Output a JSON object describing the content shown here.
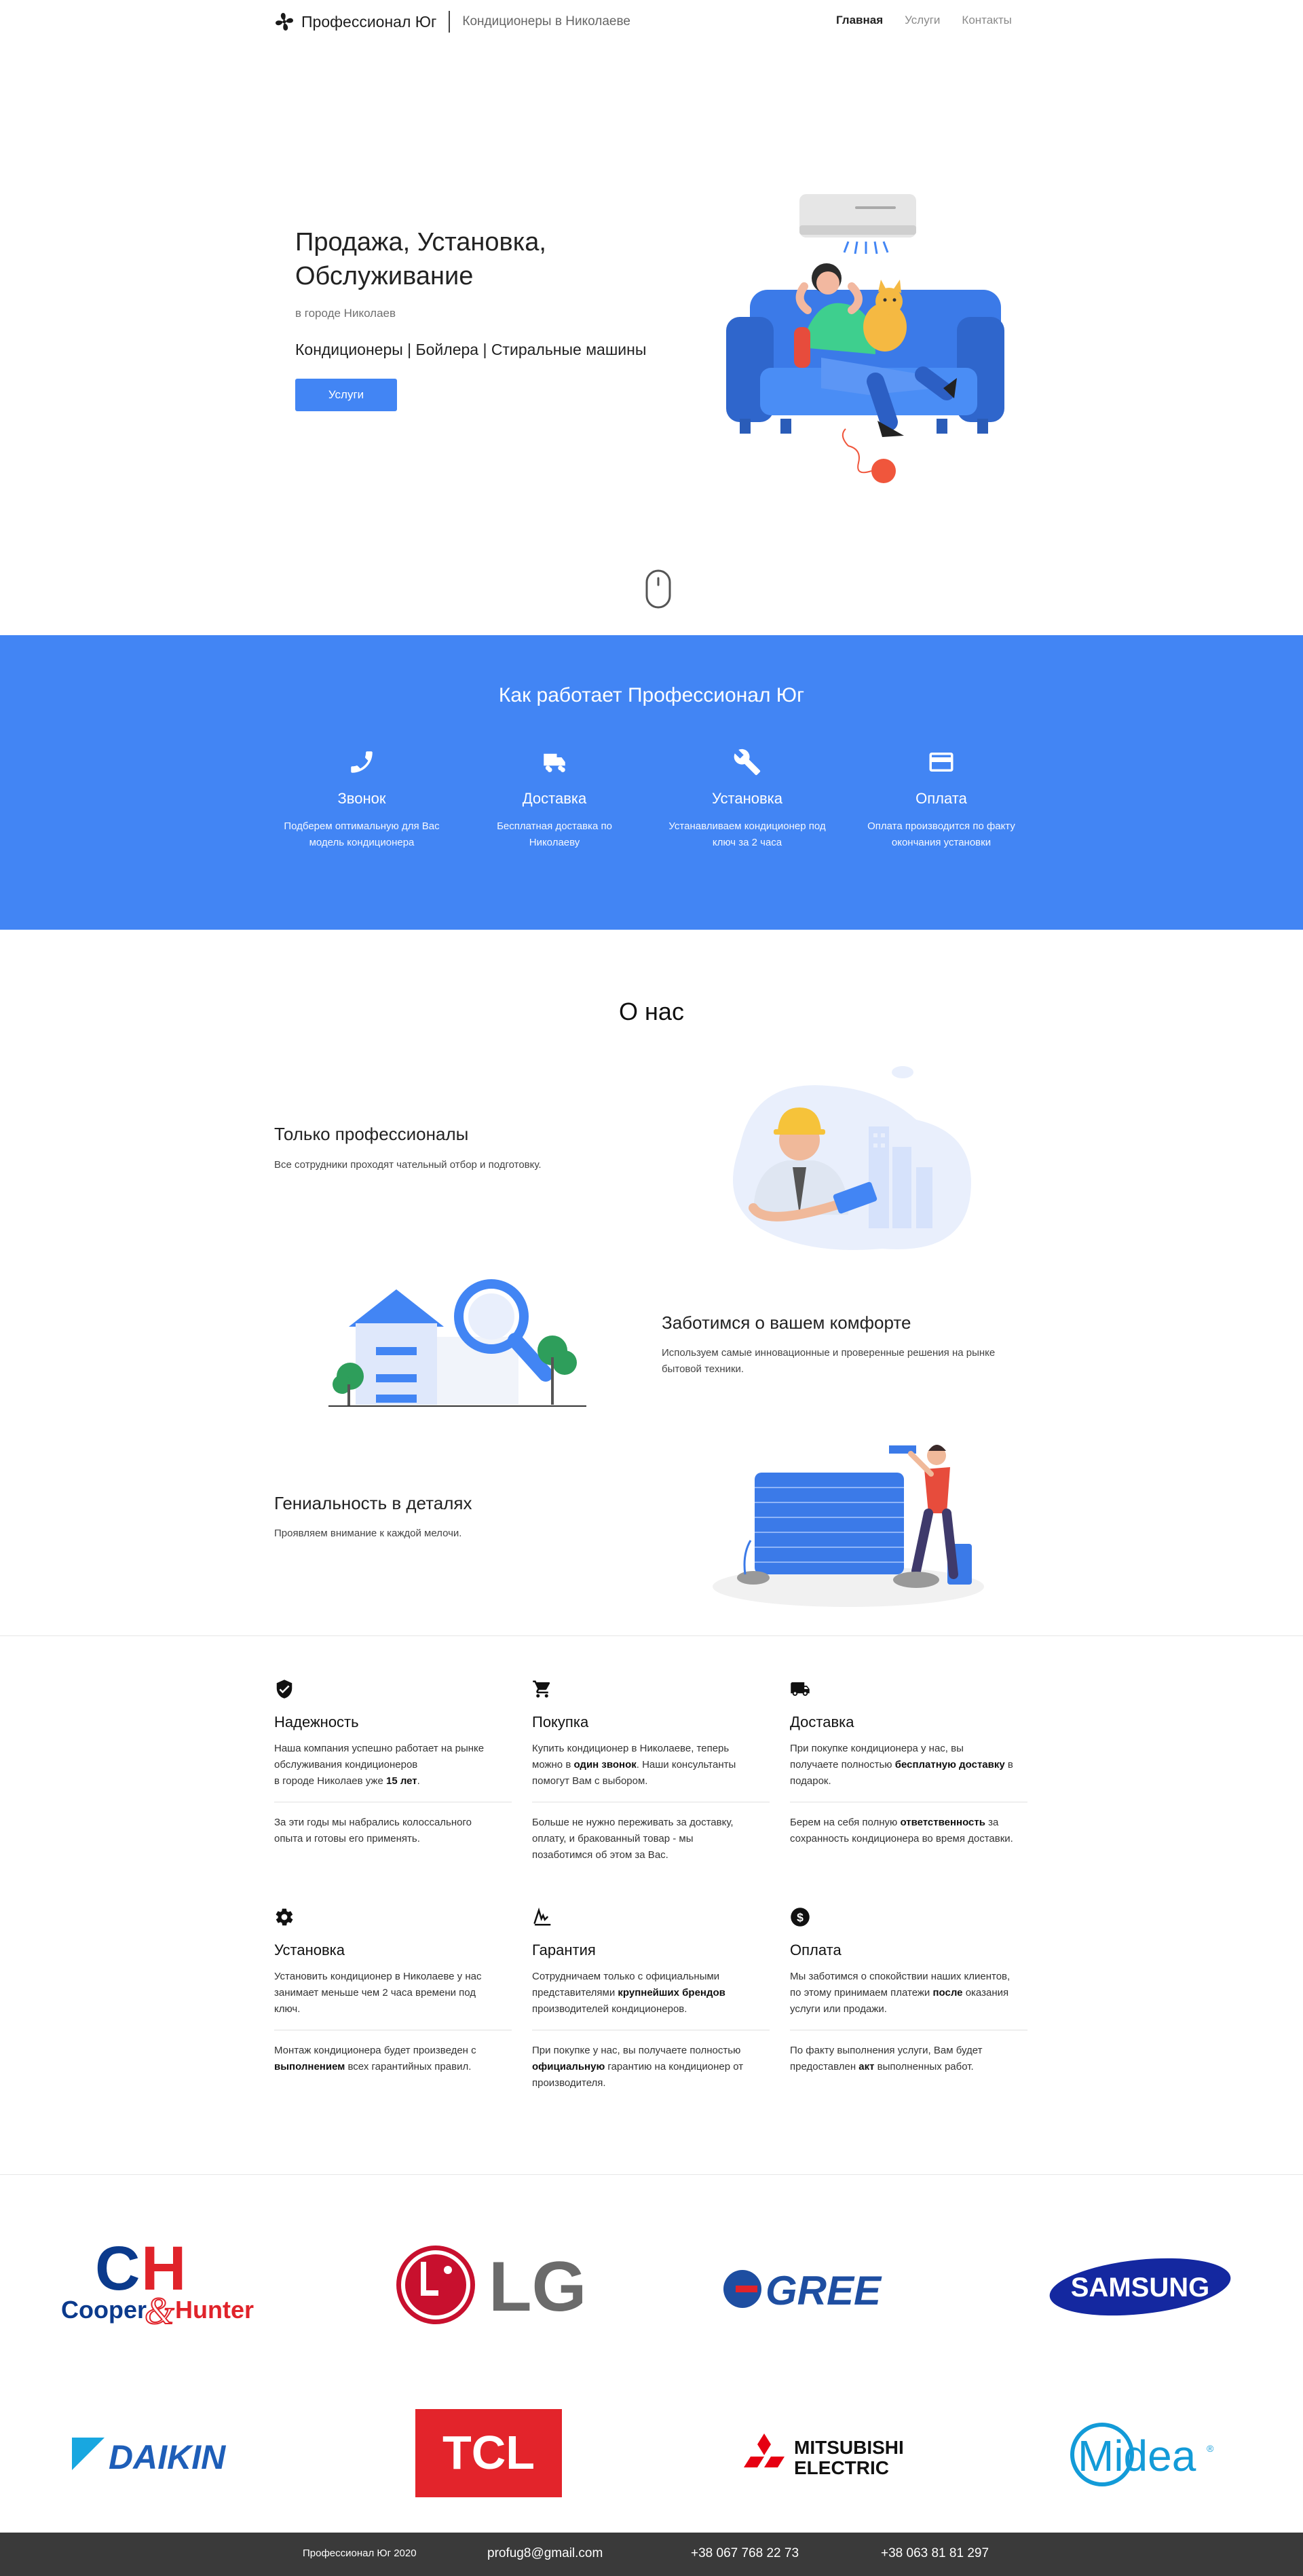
{
  "header": {
    "brand_name": "Профессионал Юг",
    "brand_sub": "Кондиционеры в Николаеве",
    "nav": [
      "Главная",
      "Услуги",
      "Контакты"
    ]
  },
  "hero": {
    "title_line1": "Продажа, Установка,",
    "title_line2": "Обслуживание",
    "city": "в городе Николаев",
    "categories": "Кондиционеры | Бойлера | Стиральные машины",
    "button": "Услуги"
  },
  "how": {
    "title": "Как работает Профессионал Юг",
    "steps": [
      {
        "icon": "phone-icon",
        "title": "Звонок",
        "desc1": "Подберем оптимальную для Вас",
        "desc2": "модель кондиционера"
      },
      {
        "icon": "truck-icon",
        "title": "Доставка",
        "desc1": "Бесплатная доставка по",
        "desc2": "Николаеву"
      },
      {
        "icon": "wrench-icon",
        "title": "Установка",
        "desc1": "Устанавливаем кондиционер под",
        "desc2": "ключ за 2 часа"
      },
      {
        "icon": "credit-card-icon",
        "title": "Оплата",
        "desc1": "Оплата производится по факту",
        "desc2": "окончания установки"
      }
    ]
  },
  "about": {
    "title": "О нас",
    "features": [
      {
        "title": "Только профессионалы",
        "text": "Все сотрудники проходят чательный отбор и подготовку."
      },
      {
        "title": "Заботимся о вашем комфорте",
        "text1": "Используем самые инновационные и проверенные решения на рынке",
        "text2": "бытовой техники."
      },
      {
        "title": "Гениальность в деталях",
        "text": "Проявляем внимание к каждой мелочи."
      }
    ]
  },
  "benefits": [
    {
      "icon": "shield-check-icon",
      "title": "Надежность",
      "p1": [
        "Наша компания успешно работает на рынке",
        "обслуживания кондиционеров",
        "в городе Николаев уже ",
        "15 лет",
        "."
      ],
      "p2": [
        "За эти годы мы набрались колоссального",
        "опыта и готовы его применять."
      ]
    },
    {
      "icon": "cart-icon",
      "title": "Покупка",
      "p1": [
        "Купить кондиционер в Николаеве, теперь",
        "можно в ",
        "один звонок",
        ". Наши консультанты",
        "помогут Вам с выбором."
      ],
      "p2": [
        "Больше не нужно переживать за доставку,",
        "оплату, и бракованный товар - мы",
        "позаботимся об этом за Вас."
      ]
    },
    {
      "icon": "truck-icon",
      "title": "Доставка",
      "p1": [
        "При покупке кондиционера у нас, вы",
        "получаете полностью ",
        "бесплатную доставку",
        " в",
        "подарок."
      ],
      "p2": [
        "Берем на себя полную ",
        "ответственность",
        " за",
        "сохранность кондиционера во время доставки."
      ]
    },
    {
      "icon": "gear-icon",
      "title": "Установка",
      "p1": [
        "Установить кондиционер в Николаеве у нас",
        "занимает меньше чем 2 часа времени под",
        "ключ."
      ],
      "p2": [
        "Монтаж кондиционера будет произведен с",
        "выполнением",
        " всех гарантийных правил."
      ]
    },
    {
      "icon": "signature-icon",
      "title": "Гарантия",
      "p1": [
        "Сотрудничаем только с официальными",
        "представителями ",
        "крупнейших брендов",
        "производителей кондиционеров."
      ],
      "p2": [
        "При покупке у нас, вы получаете полностью",
        "официальную",
        " гарантию на кондиционер от",
        "производителя."
      ]
    },
    {
      "icon": "dollar-icon",
      "title": "Оплата",
      "p1": [
        "Мы заботимся о спокойствии наших клиентов,",
        "по этому принимаем платежи ",
        "после",
        " оказания",
        "услуги или продажи."
      ],
      "p2": [
        "По факту выполнения услуги, Вам будет",
        "предоставлен ",
        "акт",
        " выполненных работ."
      ]
    }
  ],
  "brands": {
    "cooper1": "C",
    "cooper2": "H",
    "cooper_word1": "Cooper",
    "cooper_amp": "&",
    "cooper_word2": "Hunter",
    "lg": "LG",
    "gree": "GREE",
    "samsung": "SAMSUNG",
    "daikin": "DAIKIN",
    "tcl": "TCL",
    "mitsubishi1": "MITSUBISHI",
    "mitsubishi2": "ELECTRIC",
    "midea": "Midea",
    "midea_reg": "®"
  },
  "footer": {
    "copyright": "Профессионал Юг 2020",
    "email": "profug8@gmail.com",
    "phone1": "+38 067 768 22 73",
    "phone2": "+38 063 81 81 297"
  },
  "colors": {
    "accent": "#4285f4",
    "footer_bg": "#3a3a3a"
  }
}
